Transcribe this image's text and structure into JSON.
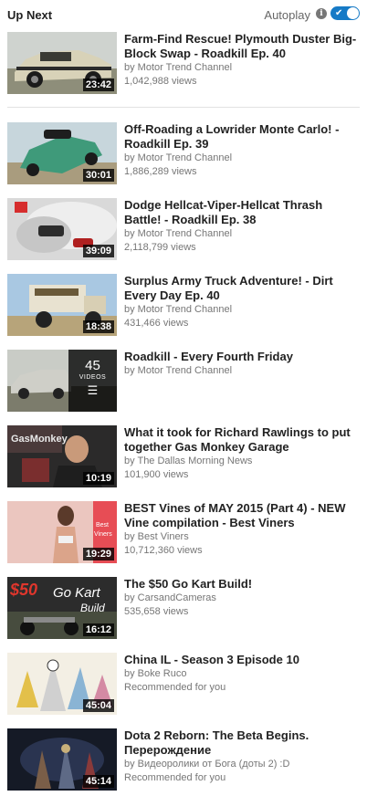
{
  "header": {
    "up_next": "Up Next",
    "autoplay_label": "Autoplay",
    "autoplay_on": true
  },
  "videos": [
    {
      "title": "Farm-Find Rescue! Plymouth Duster Big-Block Swap - Roadkill Ep. 40",
      "channel": "by Motor Trend Channel",
      "views": "1,042,988 views",
      "duration": "23:42"
    },
    {
      "title": "Off-Roading a Lowrider Monte Carlo! - Roadkill Ep. 39",
      "channel": "by Motor Trend Channel",
      "views": "1,886,289 views",
      "duration": "30:01"
    },
    {
      "title": "Dodge Hellcat-Viper-Hellcat Thrash Battle! - Roadkill Ep. 38",
      "channel": "by Motor Trend Channel",
      "views": "2,118,799 views",
      "duration": "39:09"
    },
    {
      "title": "Surplus Army Truck Adventure! - Dirt Every Day Ep. 40",
      "channel": "by Motor Trend Channel",
      "views": "431,466 views",
      "duration": "18:38"
    },
    {
      "title": "Roadkill - Every Fourth Friday",
      "channel": "by Motor Trend Channel",
      "views": "",
      "duration": "",
      "playlist_count": "45",
      "playlist_label": "VIDEOS"
    },
    {
      "title": "What it took for Richard Rawlings to put together Gas Monkey Garage",
      "channel": "by The Dallas Morning News",
      "views": "101,900 views",
      "duration": "10:19"
    },
    {
      "title": "BEST Vines of MAY 2015 (Part 4) - NEW Vine compilation - Best Viners",
      "channel": "by Best Viners",
      "views": "10,712,360 views",
      "duration": "19:29"
    },
    {
      "title": "The $50 Go Kart Build!",
      "channel": "by CarsandCameras",
      "views": "535,658 views",
      "duration": "16:12"
    },
    {
      "title": "China IL - Season 3 Episode 10",
      "channel": "by Boke Ruco",
      "views": "Recommended for you",
      "duration": "45:04"
    },
    {
      "title": "Dota 2 Reborn: The Beta Begins. Перерождение",
      "channel": "by Видеоролики от Бога (доты 2) :D",
      "views": "Recommended for you",
      "duration": "45:14"
    }
  ],
  "thumb_text": {
    "gokart_price": "$50",
    "gokart_line1": "Go Kart",
    "gokart_line2": "Build",
    "viners_line1": "Best",
    "viners_line2": "Viners",
    "gasmonkey": "GasMonkey"
  },
  "colors": {
    "toggle_on": "#167ac6",
    "title": "#222222",
    "meta": "#767676"
  }
}
